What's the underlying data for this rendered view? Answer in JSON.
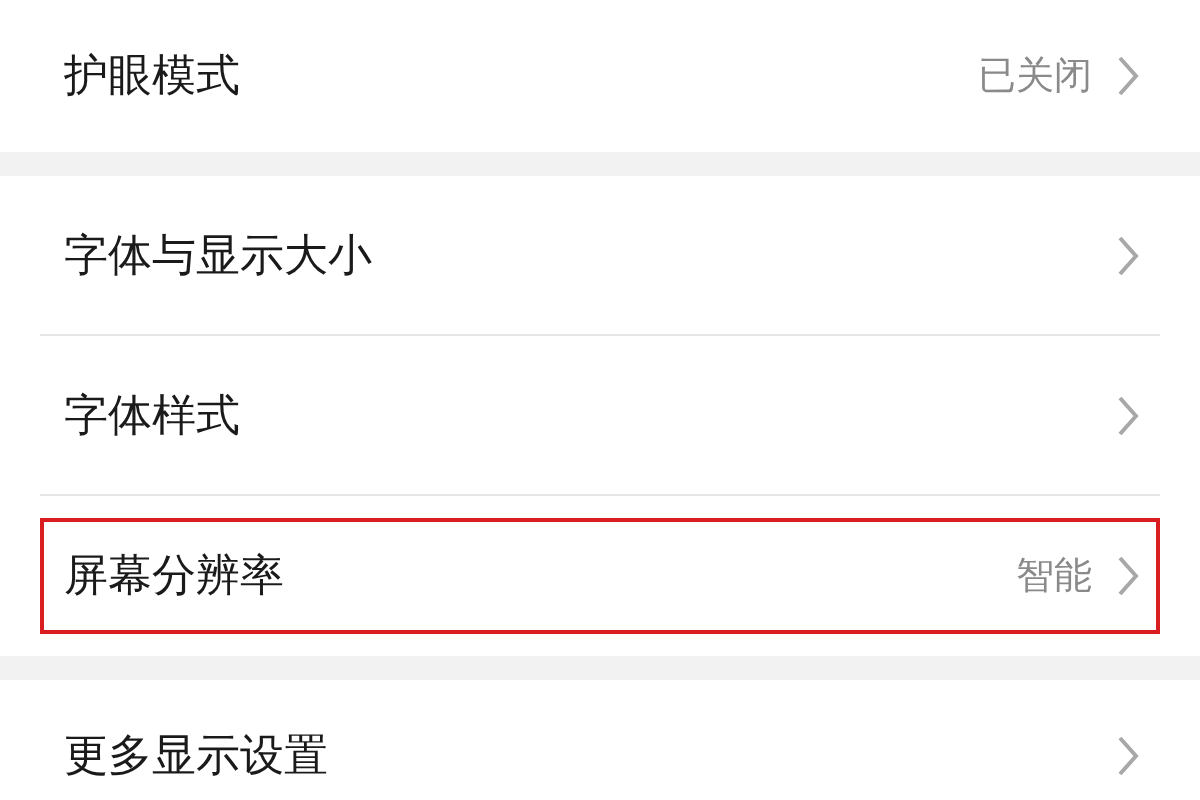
{
  "sections": [
    {
      "items": [
        {
          "label": "护眼模式",
          "value": "已关闭",
          "highlighted": false
        }
      ]
    },
    {
      "items": [
        {
          "label": "字体与显示大小",
          "highlighted": false
        },
        {
          "label": "字体样式",
          "highlighted": false
        },
        {
          "label": "屏幕分辨率",
          "value": "智能",
          "highlighted": true
        }
      ]
    },
    {
      "items": [
        {
          "label": "更多显示设置",
          "highlighted": false
        }
      ]
    }
  ]
}
